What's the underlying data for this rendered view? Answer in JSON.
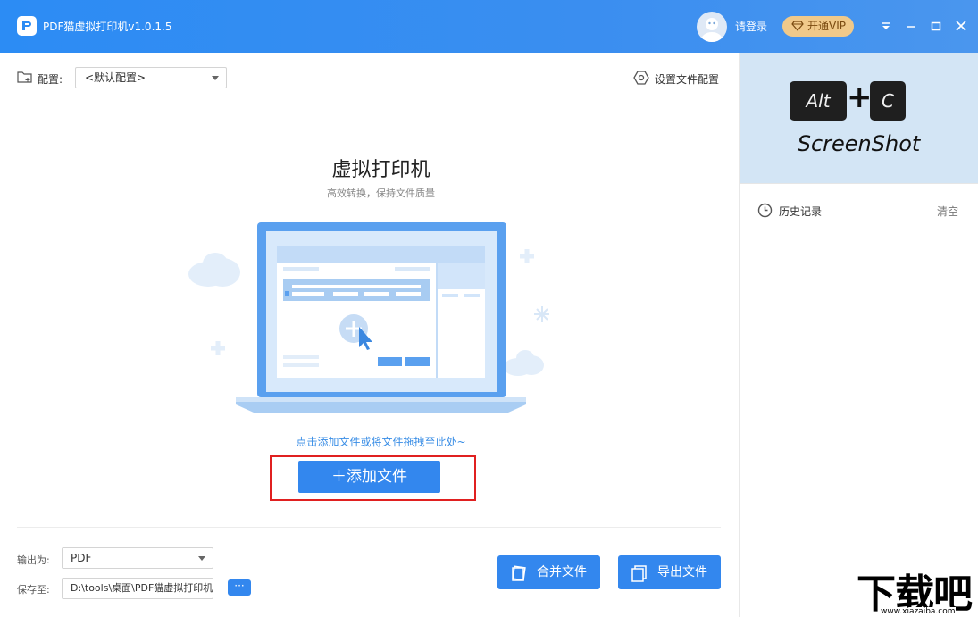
{
  "titlebar": {
    "app_title": "PDF猫虚拟打印机v1.0.1.5",
    "login_label": "请登录",
    "vip_label": "开通VIP",
    "icons": [
      "app-logo-icon",
      "diamond-icon",
      "dropdown-menu-icon",
      "minimize-icon",
      "maximize-icon",
      "close-icon"
    ]
  },
  "toolbar": {
    "config_label": "配置:",
    "config_value": "<默认配置>",
    "settings_label": "设置文件配置"
  },
  "main": {
    "title": "虚拟打印机",
    "subtitle": "高效转换，保持文件质量",
    "hint": "点击添加文件或将文件拖拽至此处~",
    "add_button": "＋添加文件"
  },
  "bottom": {
    "output_label": "输出为:",
    "output_value": "PDF",
    "save_label": "保存至:",
    "save_value": "D:\\tools\\桌面\\PDF猫虚拟打印机",
    "browse_label": "···",
    "merge_label": "合并文件",
    "export_label": "导出文件"
  },
  "sidebar": {
    "banner_key1": "Alt",
    "banner_plus": "+",
    "banner_key2": "C",
    "banner_caption": "ScreenShot",
    "history_label": "历史记录",
    "clear_label": "清空"
  },
  "watermark": {
    "big": "下载吧",
    "small": "www.xiazaiba.com"
  },
  "colors": {
    "accent": "#3387ee",
    "titlebar": "#2c8cf4",
    "vip": "#f0c98a",
    "highlight": "#e02020",
    "banner": "#d3e5f5"
  }
}
